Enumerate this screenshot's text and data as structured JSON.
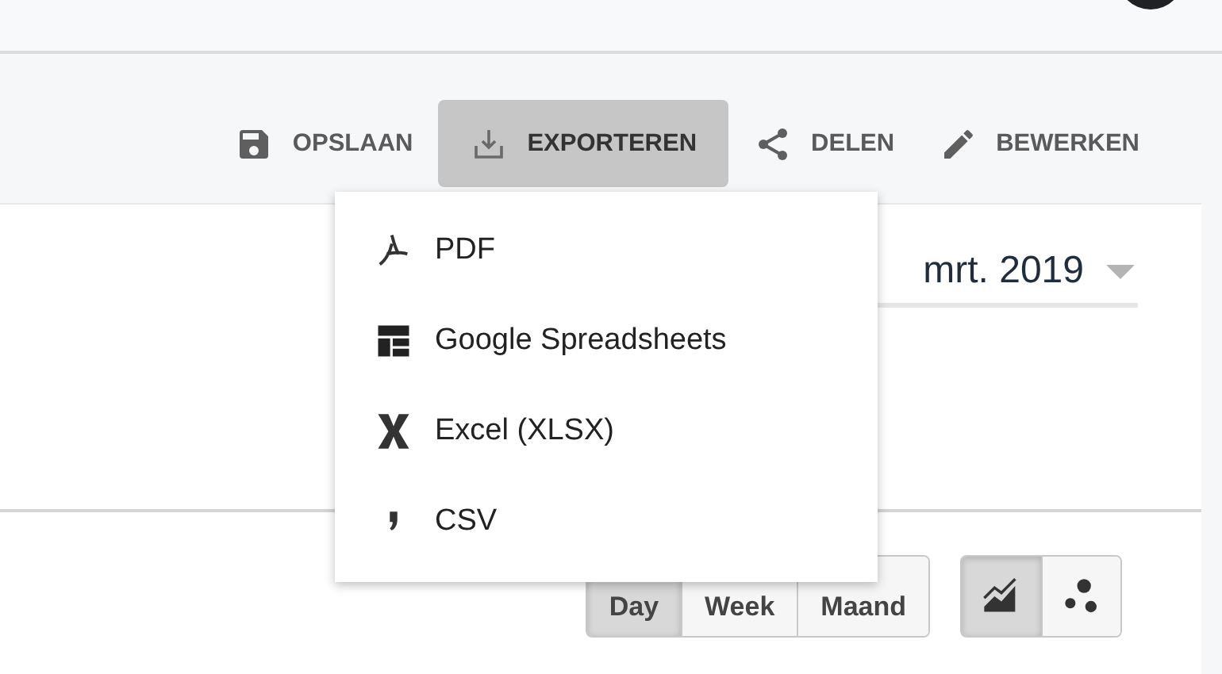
{
  "toolbar": [
    {
      "kind": "save",
      "label": "OPSLAAN",
      "selected": false
    },
    {
      "kind": "export",
      "label": "EXPORTEREN",
      "selected": true
    },
    {
      "kind": "share",
      "label": "DELEN",
      "selected": false
    },
    {
      "kind": "edit",
      "label": "BEWERKEN",
      "selected": false
    }
  ],
  "date_range": {
    "value": "mrt. 2019"
  },
  "period_buttons": [
    {
      "label": "Day",
      "selected": true
    },
    {
      "label": "Week",
      "selected": false
    },
    {
      "label": "Maand",
      "selected": false
    }
  ],
  "chart_type_buttons": [
    {
      "kind": "area",
      "selected": true
    },
    {
      "kind": "scatter",
      "selected": false
    }
  ],
  "export_menu": [
    {
      "kind": "pdf",
      "label": "PDF"
    },
    {
      "kind": "sheets",
      "label": "Google Spreadsheets"
    },
    {
      "kind": "excel",
      "label": "Excel (XLSX)"
    },
    {
      "kind": "csv",
      "label": "CSV"
    }
  ]
}
